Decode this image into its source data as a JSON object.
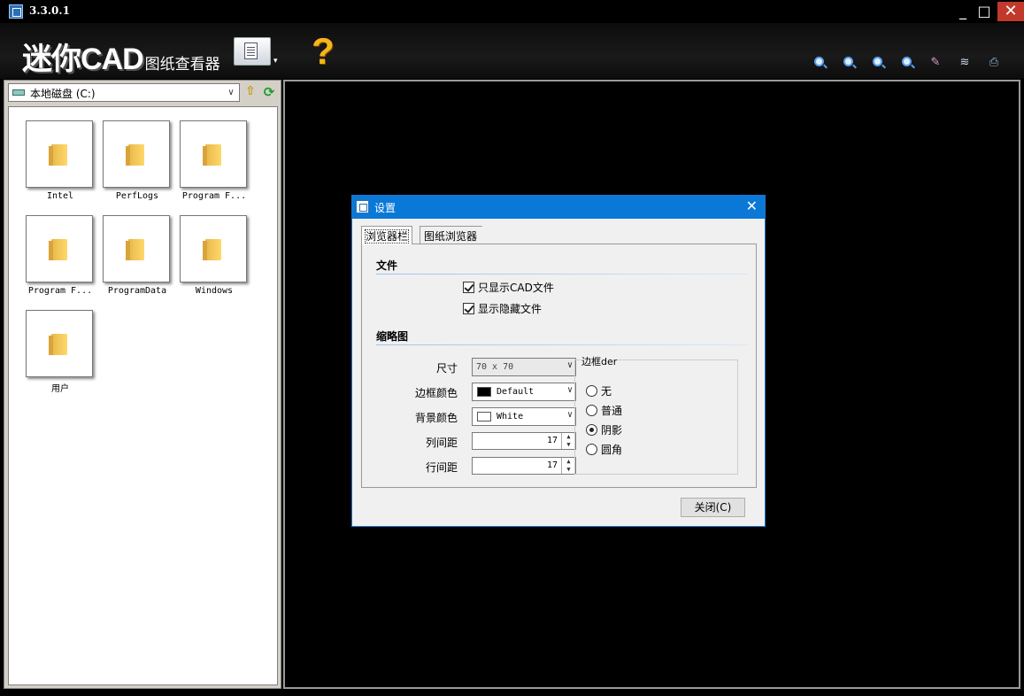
{
  "window": {
    "title": "3.3.0.1",
    "minimize": "_",
    "maximize": "□",
    "close": "✕"
  },
  "toolbar": {
    "logo_main": "迷你CAD",
    "logo_sub": "图纸查看器",
    "select_dropdown": "▾",
    "help": "?",
    "icons": [
      "zoom-in-icon",
      "zoom-out-icon",
      "zoom-fit-icon",
      "zoom-window-icon",
      "pan-icon",
      "layers-icon",
      "print-icon"
    ]
  },
  "left_panel": {
    "path": "本地磁盘 (C:)",
    "up": "⇧",
    "refresh": "⟳",
    "items": [
      {
        "label": "Intel"
      },
      {
        "label": "PerfLogs"
      },
      {
        "label": "Program F..."
      },
      {
        "label": "Program F..."
      },
      {
        "label": "ProgramData"
      },
      {
        "label": "Windows"
      },
      {
        "label": "用户"
      }
    ]
  },
  "dialog": {
    "title": "设置",
    "close": "✕",
    "tabs": [
      {
        "label": "浏览器栏",
        "active": true
      },
      {
        "label": "图纸浏览器",
        "active": false
      }
    ],
    "files_group": "文件",
    "checkboxes": [
      {
        "label": "只显示CAD文件",
        "checked": true
      },
      {
        "label": "显示隐藏文件",
        "checked": true
      }
    ],
    "thumbnail_group": "缩略图",
    "fields": {
      "size_label": "尺寸",
      "size_value": "70 x 70",
      "border_color_label": "边框颜色",
      "border_color_value": "Default",
      "border_color_swatch": "#000000",
      "bg_color_label": "背景颜色",
      "bg_color_value": "White",
      "bg_color_swatch": "#ffffff",
      "col_spacing_label": "列间距",
      "col_spacing_value": "17",
      "row_spacing_label": "行间距",
      "row_spacing_value": "17"
    },
    "border_group": {
      "title": "边框der",
      "options": [
        {
          "label": "无",
          "selected": false
        },
        {
          "label": "普通",
          "selected": false
        },
        {
          "label": "阴影",
          "selected": true
        },
        {
          "label": "圆角",
          "selected": false
        }
      ]
    },
    "close_button": "关闭(C)"
  },
  "colors": {
    "titlebar_bg": "#000000",
    "dialog_titlebar": "#0a78d7",
    "close_button": "#c0392b"
  }
}
